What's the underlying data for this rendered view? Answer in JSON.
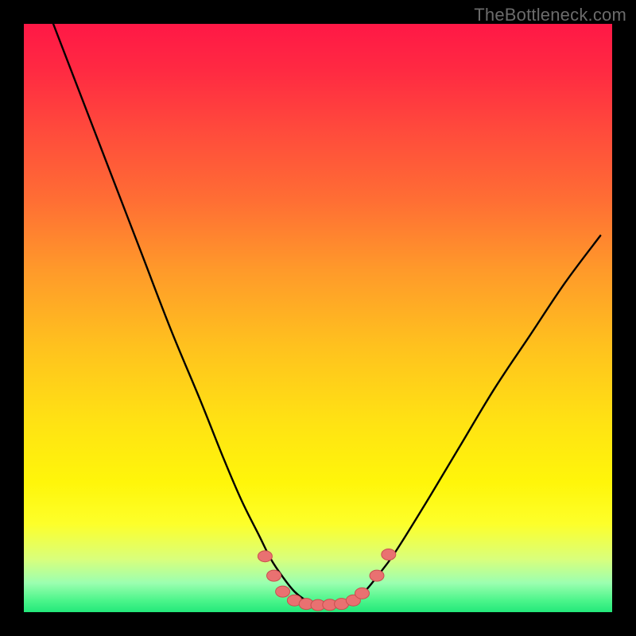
{
  "attribution": "TheBottleneck.com",
  "colors": {
    "background_black": "#000000",
    "gradient_top": "#ff1846",
    "gradient_mid": "#ffe313",
    "gradient_bottom": "#23e87a",
    "curve_color": "#000000",
    "dot_fill": "#e97171",
    "dot_stroke": "#c94f4f"
  },
  "chart_data": {
    "type": "line",
    "title": "",
    "xlabel": "",
    "ylabel": "",
    "xlim": [
      0,
      100
    ],
    "ylim": [
      0,
      100
    ],
    "series": [
      {
        "name": "bottleneck-curve",
        "x": [
          5,
          10,
          15,
          20,
          25,
          30,
          34,
          37,
          40,
          42,
          44,
          46,
          48,
          50,
          52,
          54,
          56,
          58,
          60,
          63,
          68,
          74,
          80,
          86,
          92,
          98
        ],
        "y": [
          100,
          87,
          74,
          61,
          48,
          36,
          26,
          19,
          13,
          9,
          6,
          3.5,
          2,
          1.3,
          1.1,
          1.3,
          2.1,
          3.6,
          6,
          10,
          18,
          28,
          38,
          47,
          56,
          64
        ]
      }
    ],
    "markers": [
      {
        "x": 41,
        "y": 9.5
      },
      {
        "x": 42.5,
        "y": 6.2
      },
      {
        "x": 44,
        "y": 3.5
      },
      {
        "x": 46,
        "y": 2.0
      },
      {
        "x": 48,
        "y": 1.4
      },
      {
        "x": 50,
        "y": 1.2
      },
      {
        "x": 52,
        "y": 1.25
      },
      {
        "x": 54,
        "y": 1.4
      },
      {
        "x": 56,
        "y": 2.0
      },
      {
        "x": 57.5,
        "y": 3.2
      },
      {
        "x": 60,
        "y": 6.2
      },
      {
        "x": 62,
        "y": 9.8
      }
    ]
  }
}
